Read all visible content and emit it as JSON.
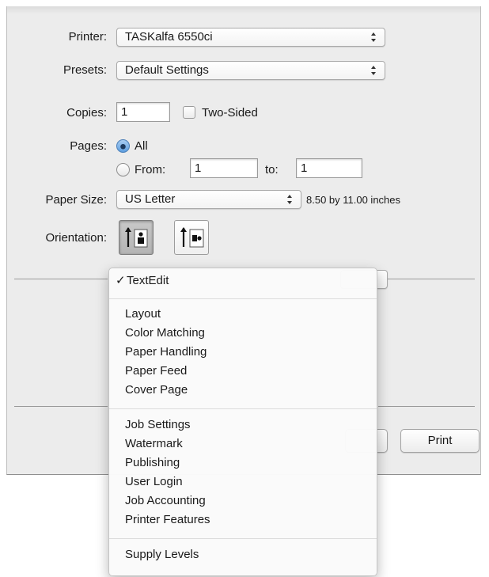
{
  "printer": {
    "label": "Printer:",
    "value": "TASKalfa 6550ci"
  },
  "presets": {
    "label": "Presets:",
    "value": "Default Settings"
  },
  "copies": {
    "label": "Copies:",
    "value": "1",
    "two_sided_label": "Two-Sided",
    "two_sided_checked": false
  },
  "pages": {
    "label": "Pages:",
    "all_label": "All",
    "from_label": "From:",
    "from_value": "1",
    "to_label": "to:",
    "to_value": "1",
    "selected": "All"
  },
  "paper": {
    "label": "Paper Size:",
    "value": "US Letter",
    "dimensions": "8.50 by 11.00 inches"
  },
  "orientation": {
    "label": "Orientation:",
    "selected": "portrait",
    "options": [
      "portrait",
      "landscape"
    ]
  },
  "print_button": "Print",
  "menu": {
    "groups": [
      {
        "items": [
          {
            "label": "TextEdit",
            "checked": true
          }
        ]
      },
      {
        "items": [
          {
            "label": "Layout"
          },
          {
            "label": "Color Matching"
          },
          {
            "label": "Paper Handling"
          },
          {
            "label": "Paper Feed"
          },
          {
            "label": "Cover Page"
          }
        ]
      },
      {
        "items": [
          {
            "label": "Job Settings"
          },
          {
            "label": "Watermark"
          },
          {
            "label": "Publishing"
          },
          {
            "label": "User Login"
          },
          {
            "label": "Job Accounting"
          },
          {
            "label": "Printer Features"
          }
        ]
      },
      {
        "items": [
          {
            "label": "Supply Levels"
          }
        ]
      }
    ],
    "check_glyph": "✓"
  }
}
